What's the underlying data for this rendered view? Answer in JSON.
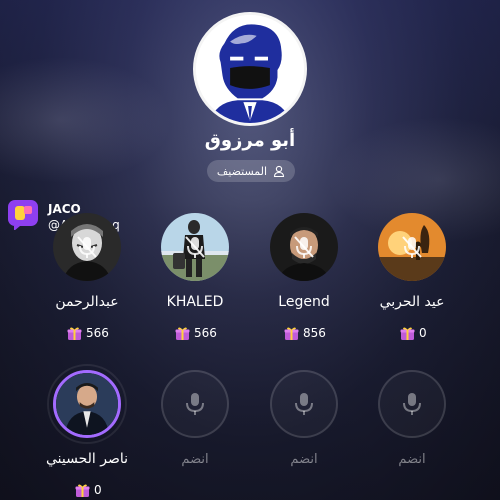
{
  "host": {
    "name": "أبو مرزوق",
    "role": "المستضيف",
    "role_icon": "user-icon"
  },
  "watermark": {
    "brand": "JACO",
    "handle": "@AboMrzoq"
  },
  "seats_row1": [
    {
      "name": "عبدالرحمن",
      "gifts": "566",
      "muted": true
    },
    {
      "name": "KHALED",
      "gifts": "566",
      "muted": true
    },
    {
      "name": "Legend",
      "gifts": "856",
      "muted": true
    },
    {
      "name": "عيد الحربي",
      "gifts": "0",
      "muted": true
    }
  ],
  "seats_row2": [
    {
      "name": "ناصر الحسيني",
      "gifts": "0",
      "speaking": true
    },
    {
      "label": "انضم",
      "empty": true
    },
    {
      "label": "انضم",
      "empty": true
    },
    {
      "label": "انضم",
      "empty": true
    }
  ],
  "colors": {
    "speaking_ring": "#a36bff",
    "gift_box": "#c05cd9",
    "watermark_logo": "#8e3ff0"
  }
}
